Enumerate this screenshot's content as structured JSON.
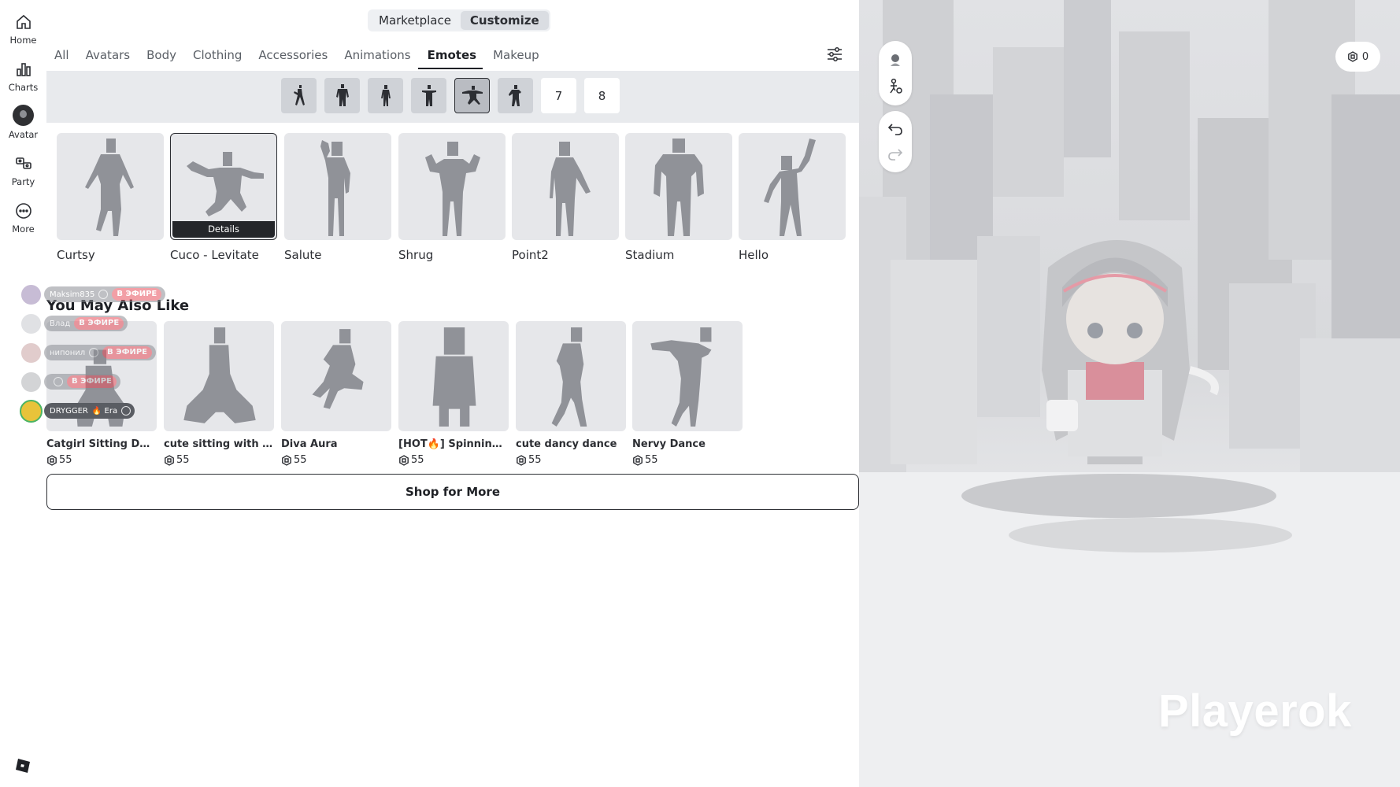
{
  "nav": {
    "items": [
      {
        "label": "Home",
        "icon": "home-icon"
      },
      {
        "label": "Charts",
        "icon": "charts-icon"
      },
      {
        "label": "Avatar",
        "icon": "avatar-icon"
      },
      {
        "label": "Party",
        "icon": "party-icon"
      },
      {
        "label": "More",
        "icon": "more-icon"
      }
    ],
    "logo_icon": "roblox-logo-icon"
  },
  "header": {
    "segments": [
      "Marketplace",
      "Customize"
    ],
    "active_segment": "Customize",
    "categories": [
      "All",
      "Avatars",
      "Body",
      "Clothing",
      "Accessories",
      "Animations",
      "Emotes",
      "Makeup"
    ],
    "active_category": "Emotes",
    "filter_icon": "sliders-icon"
  },
  "slots": {
    "filled": 6,
    "selected_index": 5,
    "empty_labels": [
      "7",
      "8"
    ]
  },
  "owned_emotes": [
    {
      "name": "Curtsy"
    },
    {
      "name": "Cuco - Levitate",
      "details_label": "Details"
    },
    {
      "name": "Salute"
    },
    {
      "name": "Shrug"
    },
    {
      "name": "Point2"
    },
    {
      "name": "Stadium"
    },
    {
      "name": "Hello"
    }
  ],
  "recommendations": {
    "title": "You May Also Like",
    "items": [
      {
        "name": "Catgirl Sitting Dow...",
        "price": "55"
      },
      {
        "name": "cute sitting with leg...",
        "price": "55"
      },
      {
        "name": "Diva Aura",
        "price": "55"
      },
      {
        "name": "[HOT🔥] Spinning Cat",
        "price": "55"
      },
      {
        "name": "cute dancy dance",
        "price": "55"
      },
      {
        "name": "Nervy Dance",
        "price": "55"
      }
    ],
    "shop_more_label": "Shop for More"
  },
  "live_overlay": [
    {
      "name": "Maksim835",
      "badge": "В ЭФИРЕ"
    },
    {
      "name": "Влад",
      "badge": "В ЭФИРЕ"
    },
    {
      "name": "нипонил",
      "badge": "В ЭФИРЕ"
    },
    {
      "name": "",
      "badge": "В ЭФИРЕ"
    },
    {
      "name": "DRYGGER",
      "extra": "🔥 Era"
    }
  ],
  "viewport": {
    "robux_balance": "0",
    "watermark": "Playerok"
  },
  "colors": {
    "accent_dark": "#1f2126",
    "live_badge": "#e8525e",
    "viewport_bg": "#dcdde0"
  }
}
